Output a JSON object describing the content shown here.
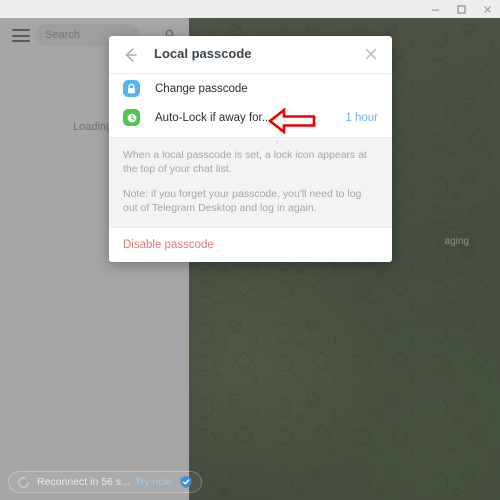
{
  "window": {
    "controls": [
      {
        "name": "minimize-button",
        "glyph": "minimize-icon"
      },
      {
        "name": "maximize-button",
        "glyph": "maximize-icon"
      },
      {
        "name": "close-button",
        "glyph": "close-icon"
      }
    ]
  },
  "sidebar": {
    "menu_icon": "hamburger-menu-icon",
    "search": {
      "placeholder": "Search",
      "value": ""
    },
    "lock_icon": "lock-icon",
    "loading_text": "Loading..."
  },
  "chat_area": {
    "wallpaper": "telegram-doodle-pattern",
    "partial_pill_label": "aging"
  },
  "modal": {
    "back_icon": "back-arrow-icon",
    "title": "Local passcode",
    "close_icon": "close-icon",
    "rows": [
      {
        "name": "change-passcode",
        "icon": "lock-icon",
        "icon_color": "#56b4ef",
        "label": "Change passcode",
        "value": ""
      },
      {
        "name": "auto-lock",
        "icon": "clock-icon",
        "icon_color": "#4dc94d",
        "label": "Auto-Lock if away for...",
        "value": "1 hour"
      }
    ],
    "help": [
      "When a local passcode is set, a lock icon appears at the top of your chat list.",
      "Note: if you forget your passcode, you'll need to log out of Telegram Desktop and log in again."
    ],
    "disable_label": "Disable passcode"
  },
  "annotation": {
    "arrow": "left-pointing-arrow-annotation",
    "color": "#ee0000"
  },
  "status_bar": {
    "spinner_icon": "loading-spinner-icon",
    "text": "Reconnect in 56 s...",
    "action_label": "Try now",
    "shield_icon": "shield-check-icon"
  },
  "colors": {
    "accent_blue": "#6ab2f2",
    "danger_red": "#e07a72",
    "icon_blue": "#56b4ef",
    "icon_green": "#4dc94d",
    "annotation_red": "#ee0000"
  }
}
